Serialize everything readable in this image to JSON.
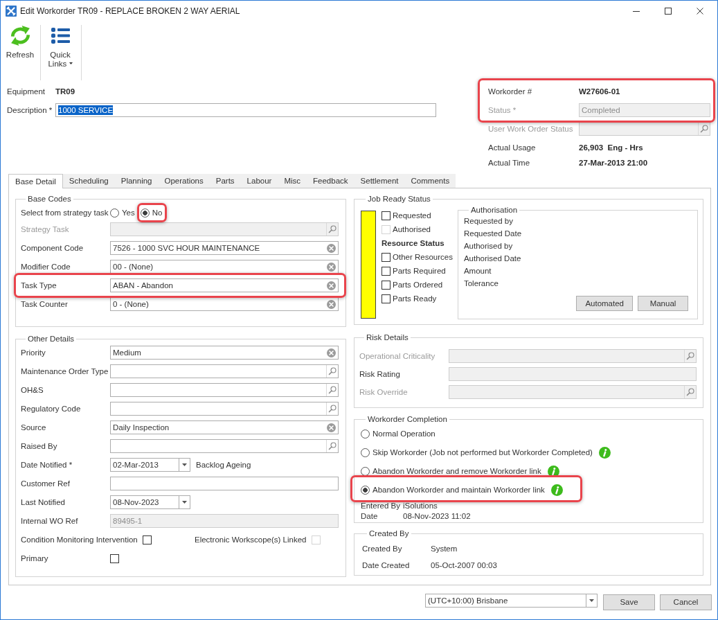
{
  "window": {
    "title": "Edit Workorder TR09 - REPLACE BROKEN 2 WAY AERIAL"
  },
  "toolbar": [
    {
      "label": "Refresh",
      "kind": "refresh"
    },
    {
      "label": "Quick Links",
      "kind": "menu"
    }
  ],
  "equipment": {
    "label": "Equipment",
    "value": "TR09"
  },
  "description": {
    "label": "Description *",
    "value": "1000 SERVICE",
    "text_selected": true
  },
  "summary": {
    "highlighted": true,
    "fields": [
      {
        "label": "Workorder #",
        "value": "W27606-01",
        "kind": "text",
        "disabled": false
      },
      {
        "label": "Status *",
        "value": "Completed",
        "kind": "input",
        "disabled": true
      }
    ]
  },
  "details": [
    {
      "label": "User Work Order Status",
      "kind": "lookup",
      "disabled": true
    },
    {
      "label": "Actual Usage",
      "value": "26,903  Eng - Hrs",
      "kind": "text",
      "disabled": false
    },
    {
      "label": "Actual Time",
      "value": "27-Mar-2013 21:00",
      "kind": "text",
      "disabled": false
    }
  ],
  "tabs": [
    {
      "label": "Base Detail",
      "selected": true
    },
    {
      "label": "Scheduling",
      "selected": false
    },
    {
      "label": "Planning",
      "selected": false
    },
    {
      "label": "Operations",
      "selected": false
    },
    {
      "label": "Parts",
      "selected": false
    },
    {
      "label": "Labour",
      "selected": false
    },
    {
      "label": "Misc",
      "selected": false
    },
    {
      "label": "Feedback",
      "selected": false
    },
    {
      "label": "Settlement",
      "selected": false
    },
    {
      "label": "Comments",
      "selected": false
    }
  ],
  "base_codes": {
    "title": "Base Codes",
    "strategy": {
      "label": "Select from strategy task",
      "options": [
        {
          "label": "Yes",
          "selected": false,
          "highlighted": false
        },
        {
          "label": "No",
          "selected": true,
          "highlighted": true
        }
      ]
    },
    "fields": [
      {
        "label": "Strategy Task",
        "kind": "lookup",
        "disabled": true,
        "highlighted": false
      },
      {
        "label": "Component Code",
        "value": "7526 - 1000 SVC HOUR MAINTENANCE",
        "kind": "clearable",
        "disabled": false,
        "highlighted": false
      },
      {
        "label": "Modifier Code",
        "value": "00 - (None)",
        "kind": "clearable",
        "disabled": false,
        "highlighted": false
      },
      {
        "label": "Task Type",
        "value": "ABAN - Abandon",
        "kind": "clearable",
        "disabled": false,
        "highlighted": true
      },
      {
        "label": "Task Counter",
        "value": "0 - (None)",
        "kind": "clearable",
        "disabled": false,
        "highlighted": false
      }
    ]
  },
  "other_details": {
    "title": "Other Details",
    "fields": [
      {
        "label": "Priority",
        "value": "Medium",
        "kind": "clearable",
        "disabled": false
      },
      {
        "label": "Maintenance Order Type",
        "kind": "lookup",
        "disabled": false
      },
      {
        "label": "OH&S",
        "kind": "lookup",
        "disabled": false
      },
      {
        "label": "Regulatory Code",
        "kind": "lookup",
        "disabled": false
      },
      {
        "label": "Source",
        "value": "Daily Inspection",
        "kind": "clearable",
        "disabled": false
      },
      {
        "label": "Raised By",
        "kind": "lookup",
        "disabled": false
      },
      {
        "label": "Date Notified *",
        "value": "02-Mar-2013",
        "kind": "date",
        "disabled": false,
        "note": "Backlog Ageing"
      },
      {
        "label": "Customer Ref",
        "kind": "input",
        "disabled": false
      },
      {
        "label": "Last Notified",
        "value": "08-Nov-2023",
        "kind": "date",
        "disabled": false
      },
      {
        "label": "Internal WO Ref",
        "value": "89495-1",
        "kind": "readonly",
        "disabled": false
      }
    ],
    "checks": [
      {
        "label": "Condition Monitoring Intervention",
        "kind": "inline",
        "checked": false,
        "disabled": false
      },
      {
        "label": "Electronic Workscope(s) Linked",
        "kind": "inline",
        "checked": false,
        "disabled": true
      },
      {
        "label": "Primary",
        "kind": "field",
        "checked": false,
        "disabled": false
      }
    ]
  },
  "job_ready_status": {
    "title": "Job Ready Status",
    "checks": [
      {
        "label": "Requested",
        "checked": false,
        "disabled": false
      },
      {
        "label": "Authorised",
        "checked": false,
        "disabled": true
      }
    ],
    "resource_title": "Resource Status",
    "resource_checks": [
      {
        "label": "Other Resources",
        "checked": false,
        "disabled": false
      },
      {
        "label": "Parts Required",
        "checked": false,
        "disabled": false
      },
      {
        "label": "Parts Ordered",
        "checked": false,
        "disabled": false
      },
      {
        "label": "Parts Ready",
        "checked": false,
        "disabled": false
      }
    ],
    "authorisation": {
      "title": "Authorisation",
      "labels": [
        "Requested by",
        "Requested Date",
        "Authorised by",
        "Authorised Date",
        "Amount",
        "Tolerance"
      ],
      "buttons": [
        "Automated",
        "Manual"
      ]
    }
  },
  "risk_details": {
    "title": "Risk Details",
    "fields": [
      {
        "label": "Operational Criticality",
        "kind": "lookup",
        "disabled": true
      },
      {
        "label": "Risk Rating",
        "kind": "readonly",
        "disabled": false
      },
      {
        "label": "Risk Override",
        "kind": "lookup",
        "disabled": true
      }
    ]
  },
  "completion": {
    "title": "Workorder Completion",
    "options": [
      {
        "label": "Normal Operation",
        "selected": false,
        "info": false,
        "highlighted": false
      },
      {
        "label": "Skip Workorder (Job not performed but Workorder Completed)",
        "selected": false,
        "info": true,
        "highlighted": false
      },
      {
        "label": "Abandon Workorder and remove Workorder link",
        "selected": false,
        "info": true,
        "highlighted": false
      },
      {
        "label": "Abandon Workorder and maintain Workorder link",
        "selected": true,
        "info": true,
        "highlighted": true
      }
    ],
    "entries": [
      {
        "label": "Entered By",
        "value": "iSolutions"
      },
      {
        "label": "Date",
        "value": "08-Nov-2023 11:02"
      }
    ]
  },
  "created": {
    "title": "Created By",
    "entries": [
      {
        "label": "Created By",
        "value": "System"
      },
      {
        "label": "Date Created",
        "value": "05-Oct-2007 00:03"
      }
    ]
  },
  "footer": {
    "timezone": "(UTC+10:00) Brisbane",
    "buttons": [
      "Save",
      "Cancel"
    ]
  }
}
